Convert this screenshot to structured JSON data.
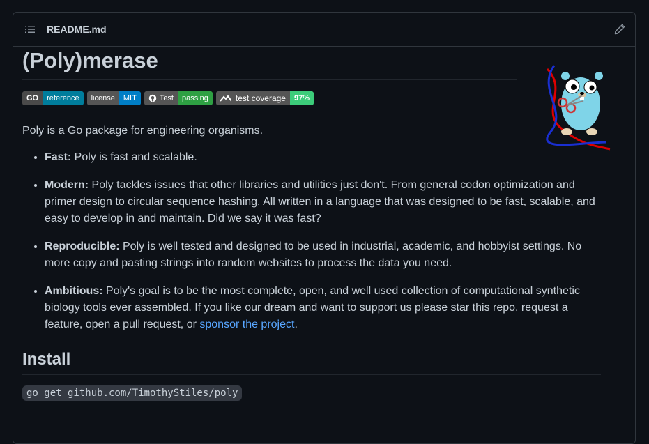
{
  "header": {
    "file_name": "README.md",
    "list_icon": "list-unordered-icon",
    "edit_icon": "pencil-icon"
  },
  "title": "(Poly)merase",
  "badges": [
    {
      "left": "GO",
      "right": "reference",
      "color": "#007d9c"
    },
    {
      "left": "license",
      "right": "MIT",
      "color": "#007ec6"
    },
    {
      "left": "Test",
      "right": "passing",
      "color": "#2ea043"
    },
    {
      "left": "test coverage",
      "right": "97%",
      "color": "#3ccc7a"
    }
  ],
  "intro": "Poly is a Go package for engineering organisms.",
  "features": [
    {
      "label": "Fast:",
      "text": " Poly is fast and scalable."
    },
    {
      "label": "Modern:",
      "text": " Poly tackles issues that other libraries and utilities just don't. From general codon optimization and primer design to circular sequence hashing. All written in a language that was designed to be fast, scalable, and easy to develop in and maintain. Did we say it was fast?"
    },
    {
      "label": "Reproducible:",
      "text": " Poly is well tested and designed to be used in industrial, academic, and hobbyist settings. No more copy and pasting strings into random websites to process the data you need."
    },
    {
      "label": "Ambitious:",
      "text": " Poly's goal is to be the most complete, open, and well used collection of computational synthetic biology tools ever assembled. If you like our dream and want to support us please star this repo, request a feature, open a pull request, or ",
      "link": "sponsor the project",
      "after": "."
    }
  ],
  "install": {
    "heading": "Install",
    "command": "go get github.com/TimothyStiles/poly"
  },
  "logo_icon": "gopher-dna-logo",
  "colors": {
    "background": "#0d1117",
    "link": "#58a6ff",
    "border": "#30363d"
  }
}
